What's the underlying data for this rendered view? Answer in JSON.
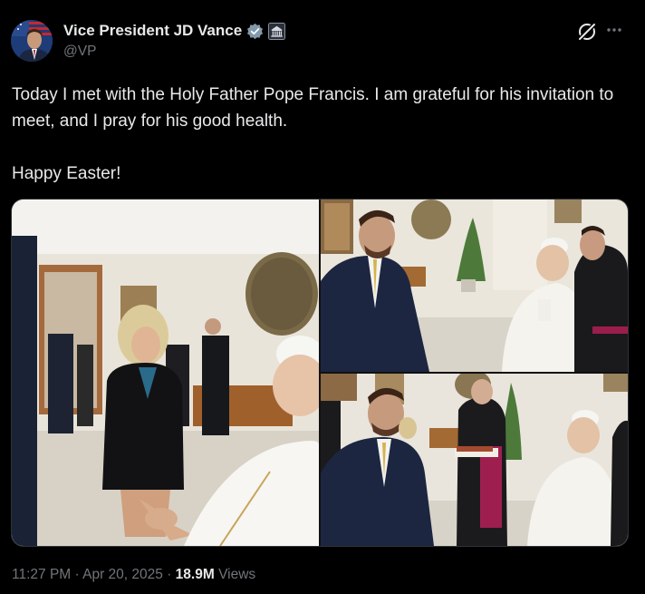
{
  "author": {
    "display_name": "Vice President JD Vance",
    "handle": "@VP",
    "avatar_icon": "avatar-flag-portrait",
    "verified_icon": "verified-badge-icon",
    "affiliation_icon": "white-house-icon"
  },
  "actions": {
    "grok_icon": "grok-icon",
    "more_icon": "more-options-icon"
  },
  "tweet": {
    "text": "Today I met with the Holy Father Pope Francis. I am grateful for his invitation to meet, and I pray for his good health.\n\nHappy Easter!"
  },
  "media": {
    "photos": [
      {
        "description_icon": "photo-handshake"
      },
      {
        "description_icon": "photo-seated-meeting"
      },
      {
        "description_icon": "photo-gift-exchange"
      }
    ]
  },
  "meta": {
    "time": "11:27 PM",
    "separator1": " · ",
    "date": "Apr 20, 2025",
    "separator2": " · ",
    "views_count": "18.9M",
    "views_label": " Views"
  },
  "colors": {
    "background": "#000000",
    "text": "#e7e9ea",
    "secondary": "#71767b",
    "verified": "#829aab"
  }
}
